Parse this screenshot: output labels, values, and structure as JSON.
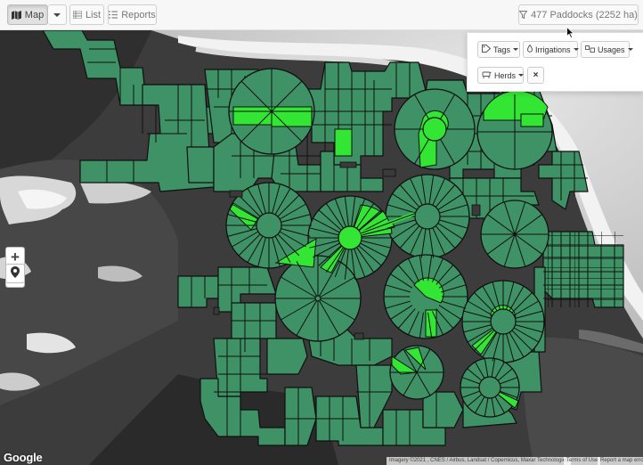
{
  "toolbar": {
    "map_label": "Map",
    "list_label": "List",
    "reports_label": "Reports",
    "paddocks_label": "477 Paddocks (2252 ha)"
  },
  "filters": {
    "tags_label": "Tags",
    "irrigations_label": "Irrigations",
    "usages_label": "Usages",
    "herds_label": "Herds",
    "clear_label": "×"
  },
  "map_controls": {
    "zoom_in": "+",
    "zoom_out": "−"
  },
  "footer": {
    "google_logo": "Google",
    "imagery": "Imagery ©2021 , CNES / Airbus, Landsat / Copernicus, Maxar Technologies",
    "terms": "Terms of Use",
    "report": "Report a map error"
  },
  "colors": {
    "paddock_fill": "#3f9265",
    "paddock_selected": "#33e633",
    "paddock_outline": "#101010",
    "toolbar_bg": "#f7f7f7"
  },
  "icons": [
    "map-icon",
    "list-icon",
    "reports-icon",
    "filter-icon",
    "tag-icon",
    "droplet-icon",
    "usages-icon",
    "herd-icon",
    "location-pin-icon"
  ]
}
